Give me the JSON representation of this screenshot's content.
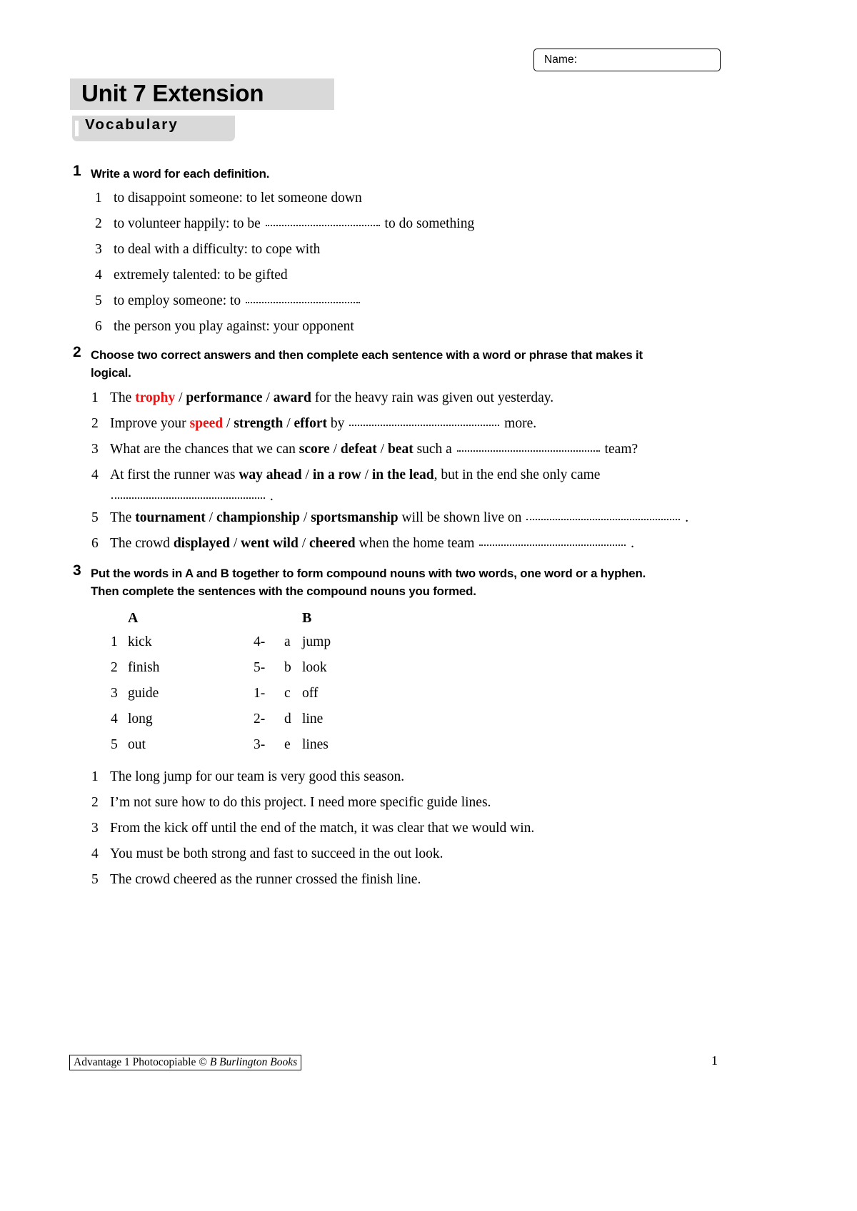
{
  "header": {
    "name_field_label": "Name:",
    "name_field_value": "",
    "unit_title": "Unit 7 Extension",
    "section_title": "Vocabulary"
  },
  "exercise1": {
    "number": "1",
    "instruction": "Write a word for each definition.",
    "items": [
      {
        "num": "1",
        "before": "to disappoint someone: to let someone down",
        "blank": 0,
        "after": ""
      },
      {
        "num": "2",
        "before": "to volunteer happily: to be ",
        "blank": 160,
        "after": " to do something"
      },
      {
        "num": "3",
        "before": "to deal with a difficulty: to cope with",
        "blank": 0,
        "after": ""
      },
      {
        "num": "4",
        "before": "extremely talented: to be gifted",
        "blank": 0,
        "after": ""
      },
      {
        "num": "5",
        "before": "to employ someone: to ",
        "blank": 160,
        "after": ""
      },
      {
        "num": "6",
        "before": "the person you play against: your opponent",
        "blank": 0,
        "after": ""
      }
    ]
  },
  "exercise2": {
    "number": "2",
    "instruction": "Choose two correct answers and then complete each sentence with a word or phrase that makes it logical.",
    "items": [
      {
        "num": "1",
        "lead": "The ",
        "choices": [
          {
            "text": "trophy",
            "red": true
          },
          {
            "text": "performance",
            "red": false
          },
          {
            "text": "award",
            "red": false
          }
        ],
        "tail_before": " for the heavy rain was given out yesterday.",
        "blank": 0,
        "tail_after": ""
      },
      {
        "num": "2",
        "lead": "Improve your ",
        "choices": [
          {
            "text": "speed",
            "red": true
          },
          {
            "text": "strength",
            "red": false
          },
          {
            "text": "effort",
            "red": false
          }
        ],
        "tail_before": " by ",
        "blank": 210,
        "tail_after": " more."
      },
      {
        "num": "3",
        "lead": "What are the chances that we can ",
        "choices": [
          {
            "text": "score",
            "red": false
          },
          {
            "text": "defeat",
            "red": false
          },
          {
            "text": "beat",
            "red": false
          }
        ],
        "tail_before": " such a ",
        "blank": 200,
        "tail_after": " team?"
      },
      {
        "num": "4",
        "lead": "At first the runner was ",
        "choices": [
          {
            "text": "way ahead",
            "red": false
          },
          {
            "text": "in a row",
            "red": false
          },
          {
            "text": "in the lead",
            "red": false
          }
        ],
        "tail_before": ", but in the end she only came",
        "blank": 0,
        "tail_after": "",
        "second_line_blank": 215,
        "second_line_after": " ."
      },
      {
        "num": "5",
        "lead": "The ",
        "choices": [
          {
            "text": "tournament",
            "red": false
          },
          {
            "text": "championship",
            "red": false
          },
          {
            "text": "sportsmanship",
            "red": false
          }
        ],
        "tail_before": " will be shown live on ",
        "blank": 215,
        "tail_after": " ."
      },
      {
        "num": "6",
        "lead": "The crowd ",
        "choices": [
          {
            "text": "displayed",
            "red": false
          },
          {
            "text": "went wild",
            "red": false
          },
          {
            "text": "cheered",
            "red": false
          }
        ],
        "tail_before": " when the home team ",
        "blank": 205,
        "tail_after": " ."
      }
    ]
  },
  "exercise3": {
    "number": "3",
    "instruction": "Put the words in A and B together to form compound nouns with two words, one word or a hyphen. Then complete the sentences with the compound nouns you formed.",
    "column_a_header": "A",
    "column_b_header": "B",
    "matching_rows": [
      {
        "a_num": "1",
        "a_word": "kick",
        "answer": "4-",
        "b_letter": "a",
        "b_word": "jump"
      },
      {
        "a_num": "2",
        "a_word": "finish",
        "answer": "5-",
        "b_letter": "b",
        "b_word": "look"
      },
      {
        "a_num": "3",
        "a_word": "guide",
        "answer": "1-",
        "b_letter": "c",
        "b_word": "off"
      },
      {
        "a_num": "4",
        "a_word": "long",
        "answer": "2-",
        "b_letter": "d",
        "b_word": "line"
      },
      {
        "a_num": "5",
        "a_word": "out",
        "answer": "3-",
        "b_letter": "e",
        "b_word": "lines"
      }
    ],
    "sentences": [
      {
        "num": "1",
        "text": "The long jump for our team is very good this season."
      },
      {
        "num": "2",
        "text": "I’m not sure how to do this project. I need more specific guide lines."
      },
      {
        "num": "3",
        "text": "From the kick off until the end of the match, it was clear that we would win."
      },
      {
        "num": "4",
        "text": "You must be both strong and fast to succeed in the out look."
      },
      {
        "num": "5",
        "text": "The crowd cheered as the runner crossed the finish line."
      }
    ]
  },
  "footer": {
    "credit_plain": "Advantage 1  Photocopiable © ",
    "credit_italic": "B Burlington Books",
    "page_number": "1"
  }
}
